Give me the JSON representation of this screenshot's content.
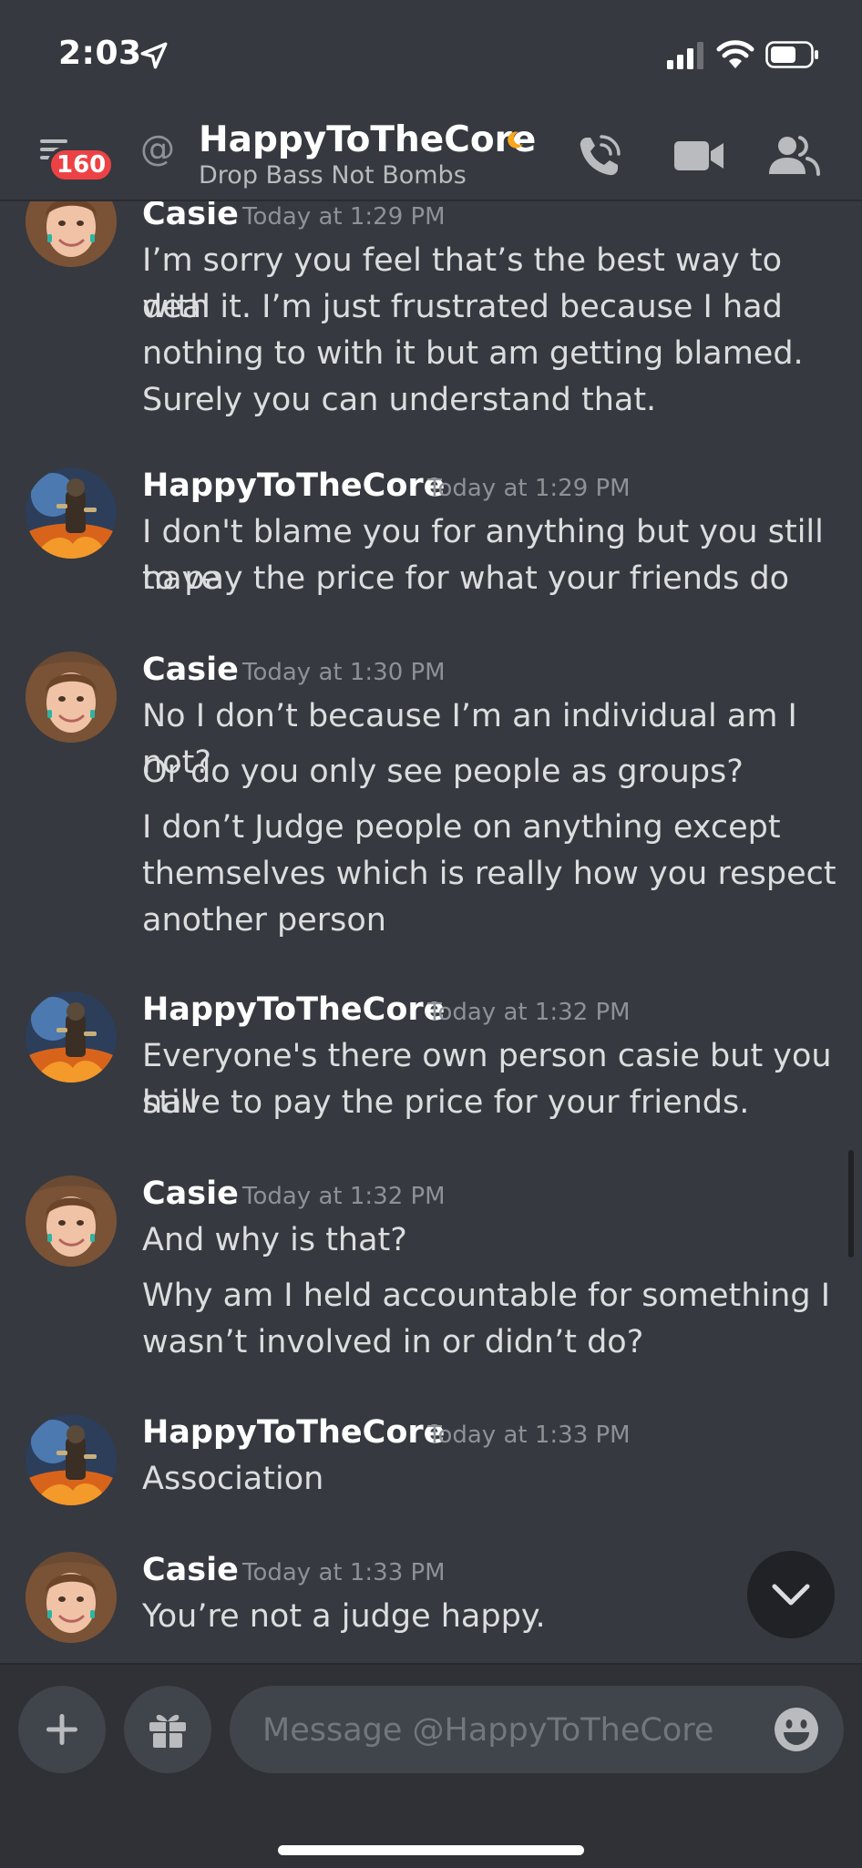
{
  "status_bar": {
    "time": "2:03"
  },
  "header": {
    "unread_count": "160",
    "at_symbol": "@",
    "username": "HappyToTheCore",
    "custom_status": "Drop Bass Not Bombs",
    "status_color": "#faa61a"
  },
  "messages": [
    {
      "author": "Casie",
      "timestamp": "Today at 1:29 PM",
      "lines": [
        "I’m sorry you feel that’s the best way to deal",
        "with it. I’m just frustrated because I had",
        "nothing to with it but am getting blamed.",
        "Surely you can understand that."
      ]
    },
    {
      "author": "HappyToTheCore",
      "timestamp": "Today at 1:29 PM",
      "lines": [
        "I don't blame you for anything but you still have",
        "to pay the price for what your friends do"
      ]
    },
    {
      "author": "Casie",
      "timestamp": "Today at 1:30 PM",
      "lines": [
        "No I don’t because I’m an individual am I not?",
        "Or do you only see people as groups?",
        "I don’t Judge people on anything except",
        "themselves which is really how you respect",
        "another person"
      ]
    },
    {
      "author": "HappyToTheCore",
      "timestamp": "Today at 1:32 PM",
      "lines": [
        "Everyone's there own person casie but you still",
        "have to pay the price for your friends."
      ]
    },
    {
      "author": "Casie",
      "timestamp": "Today at 1:32 PM",
      "lines": [
        "And why is that?",
        "Why am I held accountable for something I",
        "wasn’t involved in or didn’t do?"
      ]
    },
    {
      "author": "HappyToTheCore",
      "timestamp": "Today at 1:33 PM",
      "lines": [
        "Association"
      ]
    },
    {
      "author": "Casie",
      "timestamp": "Today at 1:33 PM",
      "lines": [
        "You’re not a judge happy."
      ]
    }
  ],
  "composer": {
    "placeholder": "Message @HappyToTheCore"
  },
  "colors": {
    "background": "#36393f",
    "composer": "#2f3136",
    "badge": "#ed4245"
  }
}
